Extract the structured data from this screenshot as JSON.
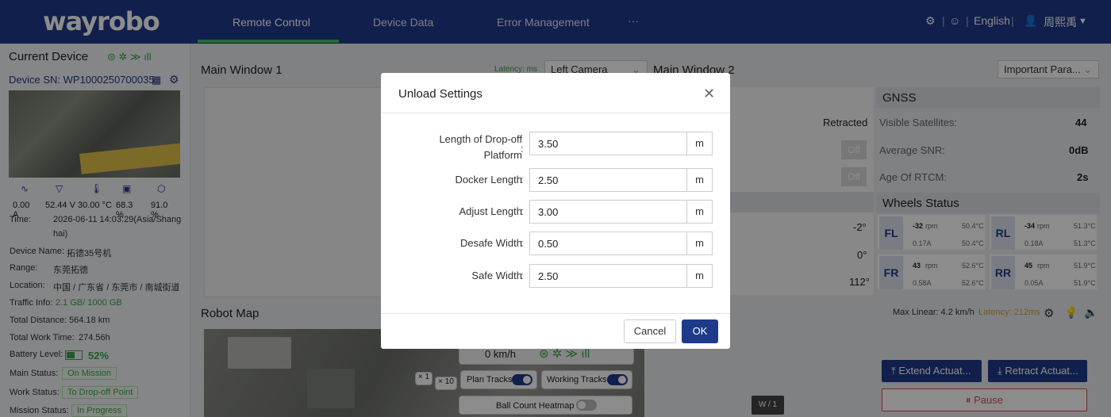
{
  "nav": {
    "logo": "wayrobo",
    "tabs": [
      "Remote Control",
      "Device Data",
      "Error Management",
      "···"
    ],
    "language": "English",
    "user": "周熙禹"
  },
  "left": {
    "title": "Current Device",
    "sn": "Device SN: WP1000250700035",
    "stats": [
      "0.00 A",
      "52.44 V",
      "30.00 °C",
      "68.3 %",
      "91.0 %"
    ],
    "info": {
      "time_k": "Time:",
      "time_v1": "2026-06-11 14:03:29(Asia/Shang",
      "time_v2": "hai)",
      "name_k": "Device Name:",
      "name_v": "拓德35号机",
      "range_k": "Range:",
      "range_v": "东莞拓德",
      "loc_k": "Location:",
      "loc_v": "中国 / 广东省 / 东莞市 / 南城街道",
      "traffic_k": "Traffic Info:",
      "traffic_v": "2.1 GB/ 1000 GB",
      "dist_k": "Total Distance:",
      "dist_v": "564.18 km",
      "work_k": "Total Work Time:",
      "work_v": "274.56h",
      "batt_k": "Battery Level:",
      "batt_v": "52%",
      "main_k": "Main Status:",
      "main_v": "On Mission",
      "wstat_k": "Work Status:",
      "wstat_v": "To Drop-off Point",
      "mission_k": "Mission Status:",
      "mission_v": "In Progress"
    }
  },
  "main1": {
    "title": "Main Window 1",
    "latency": "Latency: ms",
    "camera": "Left Camera"
  },
  "main2": {
    "title": "Main Window 2",
    "params": "Important Para...",
    "retracted": "Retracted",
    "off1": "Off",
    "off2": "Off",
    "angle1": "-2°",
    "angle2": "0°",
    "angle3": "112°"
  },
  "gnss": {
    "title": "GNSS",
    "sat_k": "Visible Satellites:",
    "sat_v": "44",
    "snr_k": "Average SNR:",
    "snr_v": "0dB",
    "rtcm_k": "Age Of RTCM:",
    "rtcm_v": "2s"
  },
  "wheels": {
    "title": "Wheels Status",
    "items": [
      {
        "label": "FL",
        "rpm": "-32",
        "unit": "rpm",
        "amp": "0.17A",
        "t1": "50.4°C",
        "t2": "50.4°C"
      },
      {
        "label": "RL",
        "rpm": "-34",
        "unit": "rpm",
        "amp": "0.18A",
        "t1": "51.3°C",
        "t2": "51.3°C"
      },
      {
        "label": "FR",
        "rpm": "43",
        "unit": "rpm",
        "amp": "0.58A",
        "t1": "52.6°C",
        "t2": "52.6°C"
      },
      {
        "label": "RR",
        "rpm": "45",
        "unit": "rpm",
        "amp": "0.05A",
        "t1": "51.9°C",
        "t2": "51.9°C"
      }
    ],
    "max_linear": "Max Linear: 4.2 km/h",
    "latency": "Latency: 212ms"
  },
  "map": {
    "title": "Robot Map",
    "speed": "0 km/h",
    "plan": "Plan Tracks",
    "working": "Working Tracks",
    "heatmap": "Ball Count Heatmap",
    "zoom1": "× 1",
    "zoom10": "× 10",
    "wpage": "W / 1"
  },
  "actions": {
    "extend": "Extend Actuat...",
    "retract": "Retract Actuat...",
    "pause": "Pause"
  },
  "modal": {
    "title": "Unload Settings",
    "fields": [
      {
        "label1": "Length of Drop-off",
        "label2": "Platform",
        "value": "3.50",
        "unit": "m"
      },
      {
        "label1": "Docker Length",
        "value": "2.50",
        "unit": "m"
      },
      {
        "label1": "Adjust Length",
        "value": "3.00",
        "unit": "m"
      },
      {
        "label1": "Desafe Width",
        "value": "0.50",
        "unit": "m"
      },
      {
        "label1": "Safe Width",
        "value": "2.50",
        "unit": "m"
      }
    ],
    "cancel": "Cancel",
    "ok": "OK"
  },
  "colors": {
    "brand": "#1e3a8a",
    "accent_green": "#3fbf6a",
    "danger": "#e04a4a"
  }
}
